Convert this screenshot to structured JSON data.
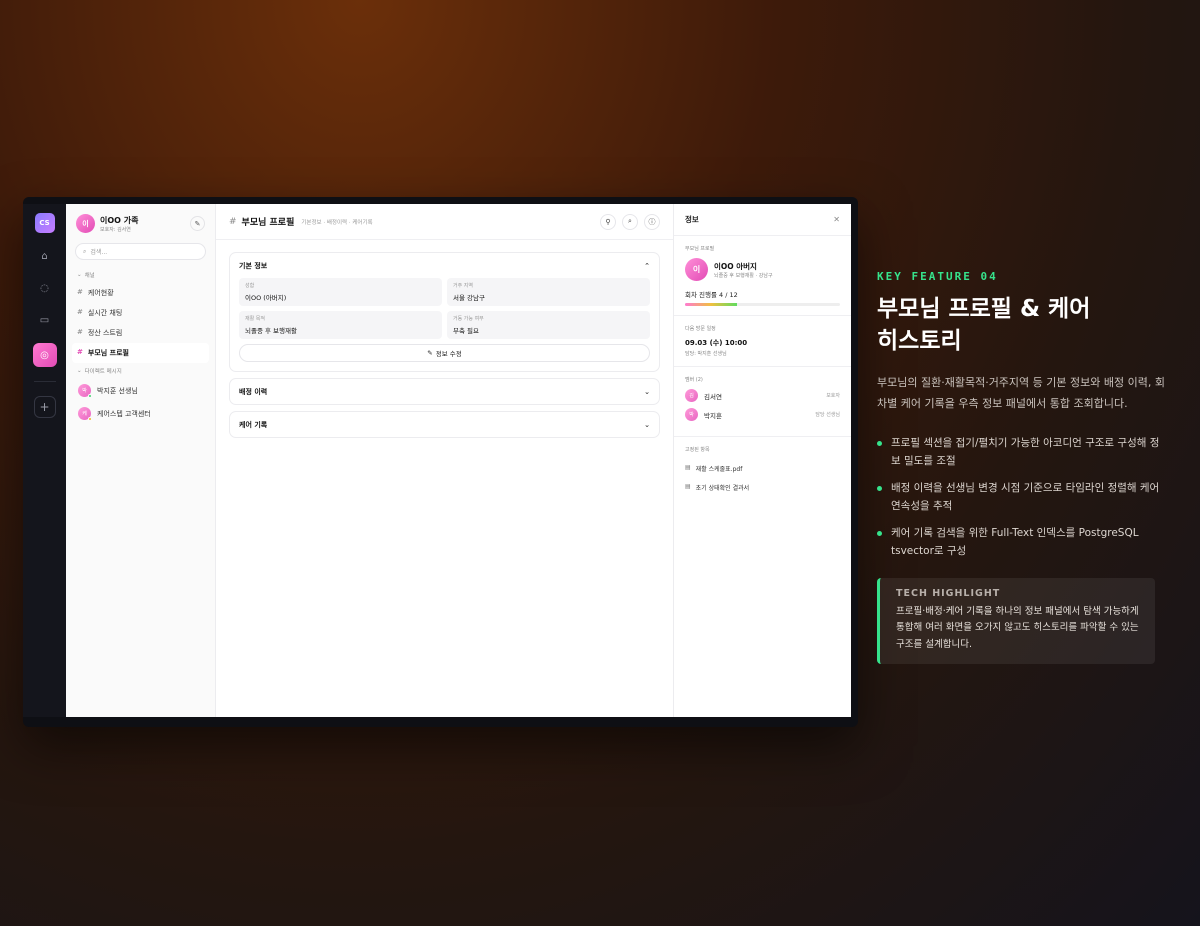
{
  "rail": {
    "logo": "CS"
  },
  "sidebar": {
    "title": "이OO 가족",
    "subtitle": "보호자: 김서연",
    "avatar_letter": "이",
    "search_placeholder": "검색...",
    "channels_group": "채널",
    "channels": [
      "케어현황",
      "실시간 채팅",
      "정산 스트림",
      "부모님 프로필"
    ],
    "dm_group": "다이렉트 메시지",
    "dms": [
      {
        "letter": "박",
        "name": "박지훈 선생님",
        "status_color": "#3ecf6e"
      },
      {
        "letter": "케",
        "name": "케어스텝 고객센터",
        "status_color": "#f0b429"
      }
    ]
  },
  "main": {
    "title": "부모님 프로필",
    "breadcrumb": "기본정보 · 배정이력 · 케어기록",
    "basic": {
      "title": "기본 정보",
      "fields": [
        {
          "k": "성함",
          "v": "이OO (아버지)"
        },
        {
          "k": "거주 지역",
          "v": "서울 강남구"
        },
        {
          "k": "재활 목적",
          "v": "뇌졸중 후 보행재활"
        },
        {
          "k": "거동 가능 여부",
          "v": "부축 필요"
        }
      ],
      "edit_label": "정보 수정"
    },
    "assign_title": "배정 이력",
    "care_title": "케어 기록"
  },
  "info": {
    "title": "정보",
    "profile_label": "부모님 프로필",
    "name": "이OO 아버지",
    "avatar_letter": "이",
    "desc": "뇌졸중 후 보행재활 · 강남구",
    "progress_text": "회차 진행률 4 / 12",
    "progress": 0.333,
    "visit_label": "다음 방문 일정",
    "visit_date": "09.03 (수) 10:00",
    "visit_who": "담당: 박지훈 선생님",
    "members_label": "멤버 (2)",
    "members": [
      {
        "letter": "김",
        "name": "김서연",
        "role": "보호자"
      },
      {
        "letter": "박",
        "name": "박지훈",
        "role": "담당 선생님"
      }
    ],
    "pinned_label": "고정된 항목",
    "pinned": [
      "재활 스케줄표.pdf",
      "초기 상태확인 결과서"
    ]
  },
  "feature": {
    "kicker": "KEY FEATURE 04",
    "title_l1": "부모님 프로필 & 케어",
    "title_l2": "히스토리",
    "desc": "부모님의 질환·재활목적·거주지역 등 기본 정보와 배정 이력, 회차별 케어 기록을 우측 정보 패널에서 통합 조회합니다.",
    "bullets": [
      "프로필 섹션을 접기/펼치기 가능한 아코디언 구조로 구성해 정보 밀도를 조절",
      "배정 이력을 선생님 변경 시점 기준으로 타임라인 정렬해 케어 연속성을 추적",
      "케어 기록 검색을 위한 Full-Text 인덱스를 PostgreSQL tsvector로 구성"
    ],
    "tech_title": "TECH HIGHLIGHT",
    "tech_text": "프로필·배정·케어 기록을 하나의 정보 패널에서 탐색 가능하게 통합해 여러 화면을 오가지 않고도 히스토리를 파악할 수 있는 구조를 설계합니다."
  }
}
